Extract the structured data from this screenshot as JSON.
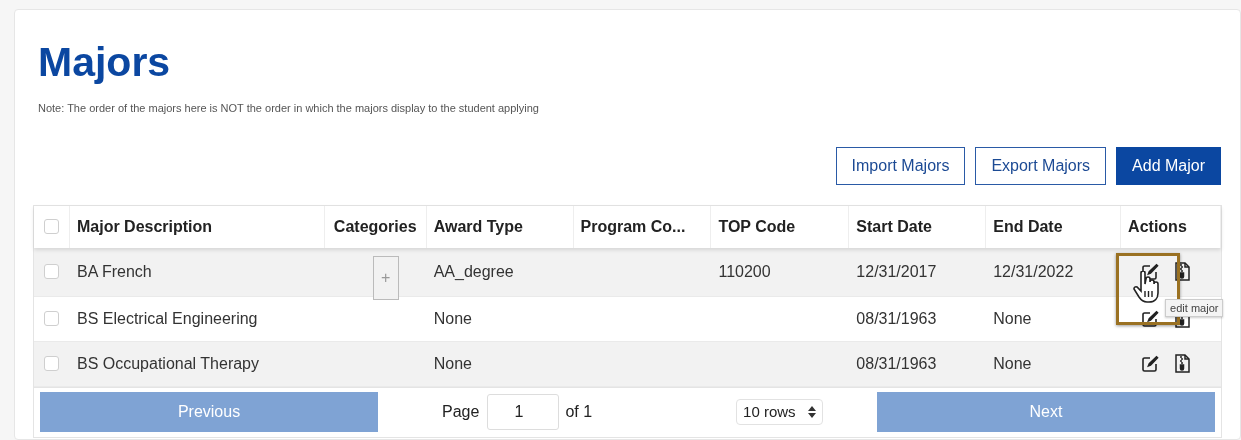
{
  "title": "Majors",
  "note": "Note: The order of the majors here is NOT the order in which the majors display to the student applying",
  "buttons": [
    {
      "label": "Import Majors",
      "kind": "outline"
    },
    {
      "label": "Export Majors",
      "kind": "outline"
    },
    {
      "label": "Add Major",
      "kind": "primary"
    }
  ],
  "table": {
    "select_all": {
      "checked": false
    },
    "columns": [
      "Major Description",
      "Categories",
      "Award Type",
      "Program Co...",
      "TOP Code",
      "Start Date",
      "End Date",
      "Actions"
    ],
    "rows": [
      {
        "checked": false,
        "cells": [
          "BA French",
          "",
          "AA_degree",
          "",
          "110200",
          "12/31/2017",
          "12/31/2022"
        ],
        "categories_button": "+",
        "hovered": true
      },
      {
        "checked": false,
        "cells": [
          "BS Electrical Engineering",
          "",
          "None",
          "",
          "",
          "08/31/1963",
          "None"
        ],
        "hovered": false
      },
      {
        "checked": false,
        "cells": [
          "BS Occupational Therapy",
          "",
          "None",
          "",
          "",
          "08/31/1963",
          "None"
        ],
        "hovered": false
      }
    ]
  },
  "tooltip": "edit major",
  "pagination": {
    "previous": "Previous",
    "page_label": "Page",
    "page_value": "1",
    "of_label": "of 1",
    "rows_select": "10 rows",
    "next": "Next"
  }
}
